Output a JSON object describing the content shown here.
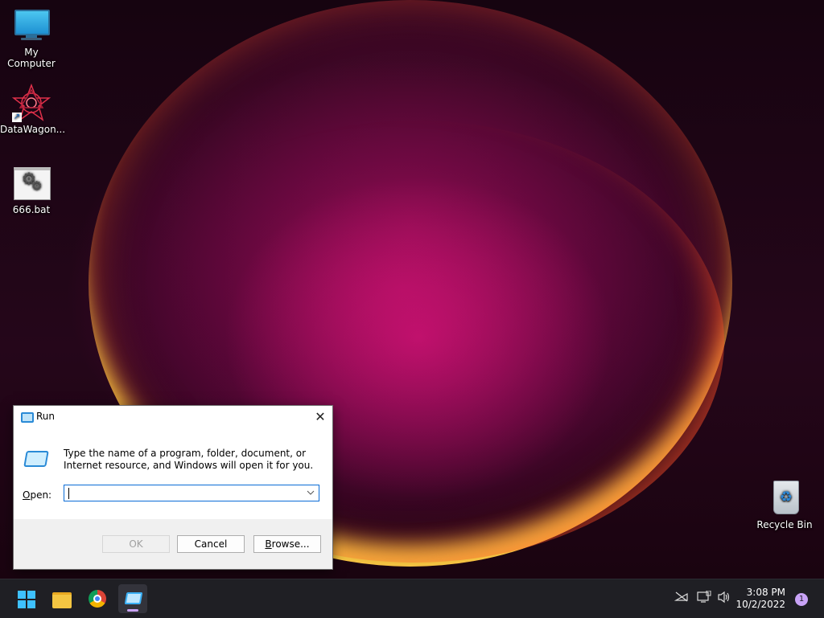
{
  "desktop": {
    "icons": [
      {
        "label": "My Computer",
        "icon": "monitor-icon"
      },
      {
        "label": "DataWagon...",
        "icon": "datawagon-icon"
      },
      {
        "label": "666.bat",
        "icon": "batch-file-icon"
      },
      {
        "label": "Recycle Bin",
        "icon": "recycle-bin-icon"
      }
    ]
  },
  "run_dialog": {
    "title": "Run",
    "description": "Type the name of a program, folder, document, or Internet resource, and Windows will open it for you.",
    "open_label_prefix": "",
    "open_label_underlined": "O",
    "open_label_rest": "pen:",
    "open_value": "",
    "buttons": {
      "ok": "OK",
      "cancel": "Cancel",
      "browse_underlined": "B",
      "browse_rest": "rowse..."
    }
  },
  "taskbar": {
    "apps": [
      "start-icon",
      "file-explorer-icon",
      "chrome-icon",
      "run-icon"
    ],
    "clock_time": "3:08 PM",
    "clock_date": "10/2/2022",
    "notification_count": "1",
    "colors": {
      "accent": "#c9a3f7",
      "taskbar_bg": "#1f1f24"
    }
  }
}
